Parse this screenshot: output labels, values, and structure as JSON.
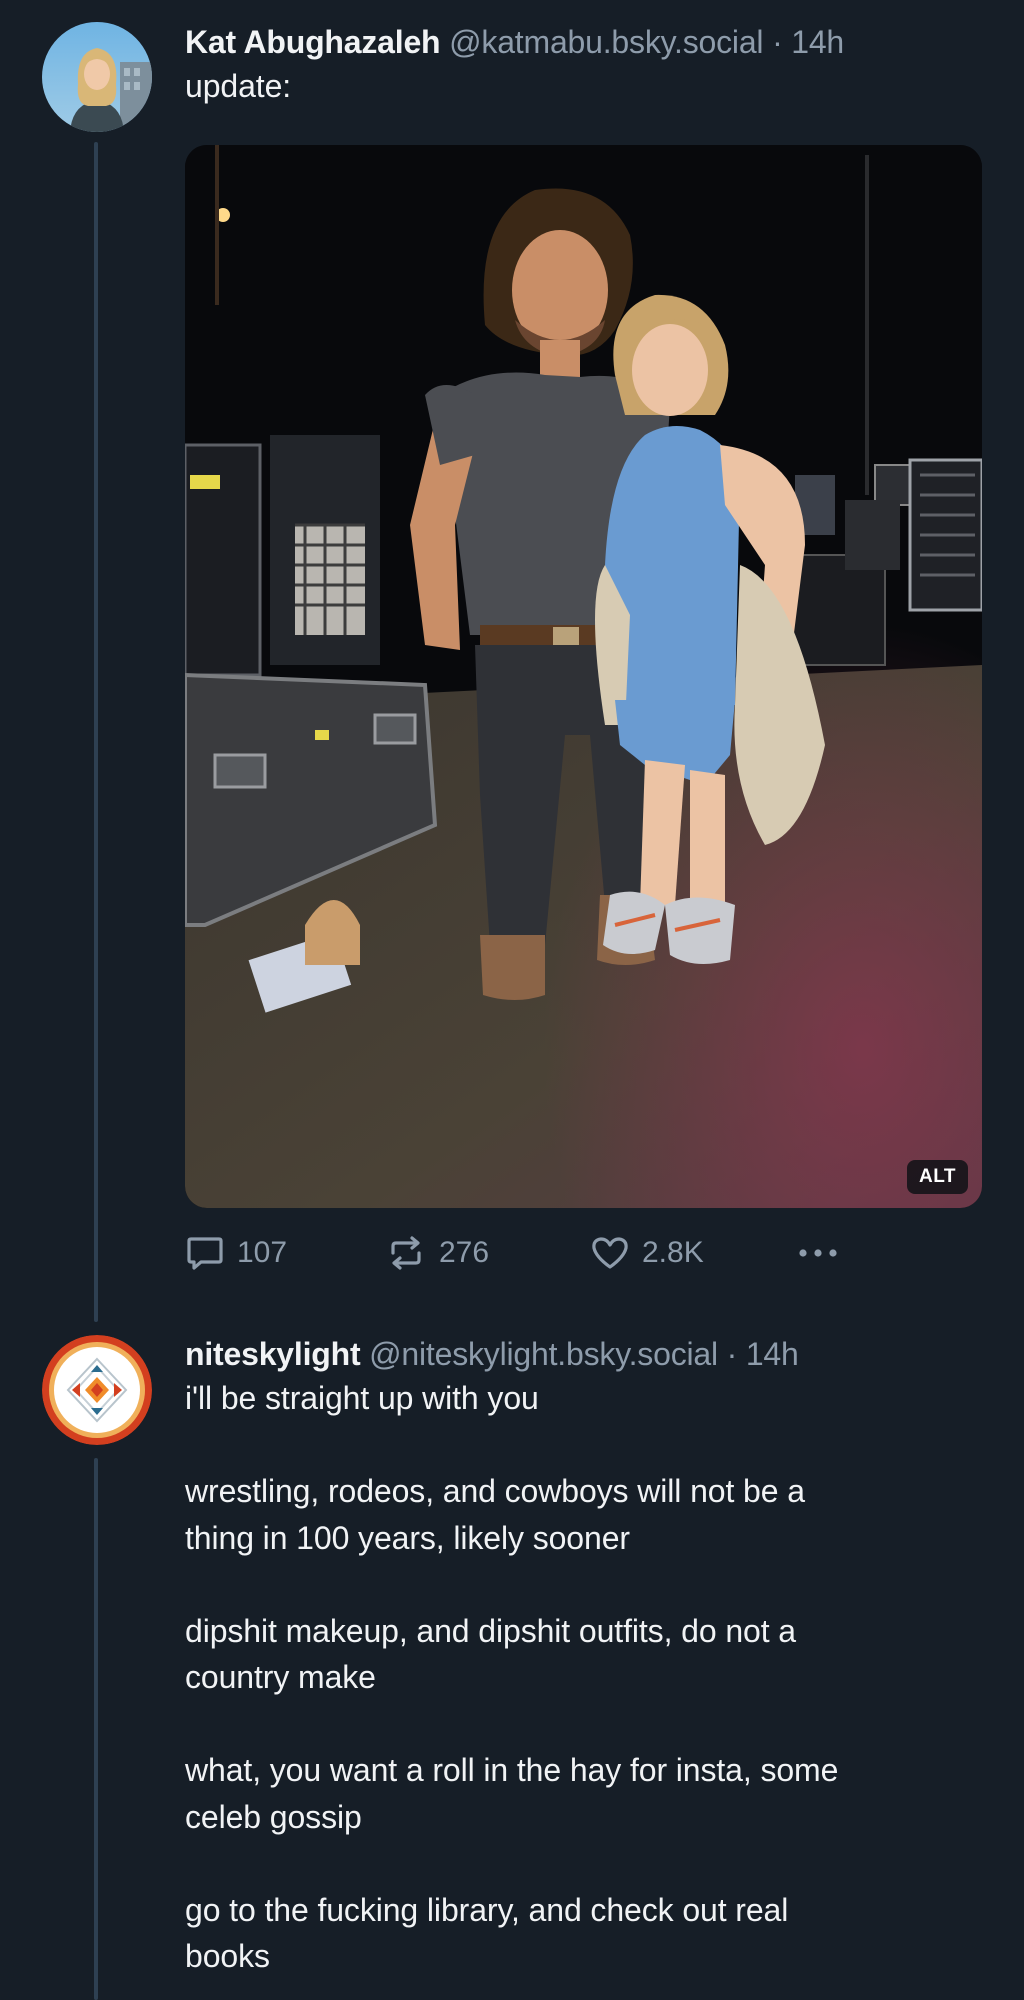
{
  "posts": [
    {
      "author": {
        "display_name": "Kat Abughazaleh",
        "handle": "@katmabu.bsky.social",
        "separator": "·",
        "time": "14h"
      },
      "text": "update:",
      "image": {
        "alt_badge": "ALT"
      },
      "stats": {
        "replies": "107",
        "reposts": "276",
        "likes": "2.8K"
      }
    },
    {
      "author": {
        "display_name": "niteskylight",
        "handle": "@niteskylight.bsky.social",
        "separator": "·",
        "time": "14h"
      },
      "text": "i'll be straight up with you\n\nwrestling, rodeos, and cowboys will not be a\nthing in 100 years, likely sooner\n\ndipshit makeup, and dipshit outfits, do not a\ncountry make\n\nwhat, you want a roll in the hay for insta, some\nceleb gossip\n\ngo to the fucking library, and check out real\nbooks"
    }
  ],
  "icons": {
    "reply": "speech-bubble-icon",
    "repost": "repost-arrows-icon",
    "like": "heart-icon",
    "more": "ellipsis-icon"
  },
  "colors": {
    "background": "#161e27",
    "thread_line": "#2e4052",
    "muted_text": "#8e9cab",
    "primary_text": "#f1f3f5"
  }
}
